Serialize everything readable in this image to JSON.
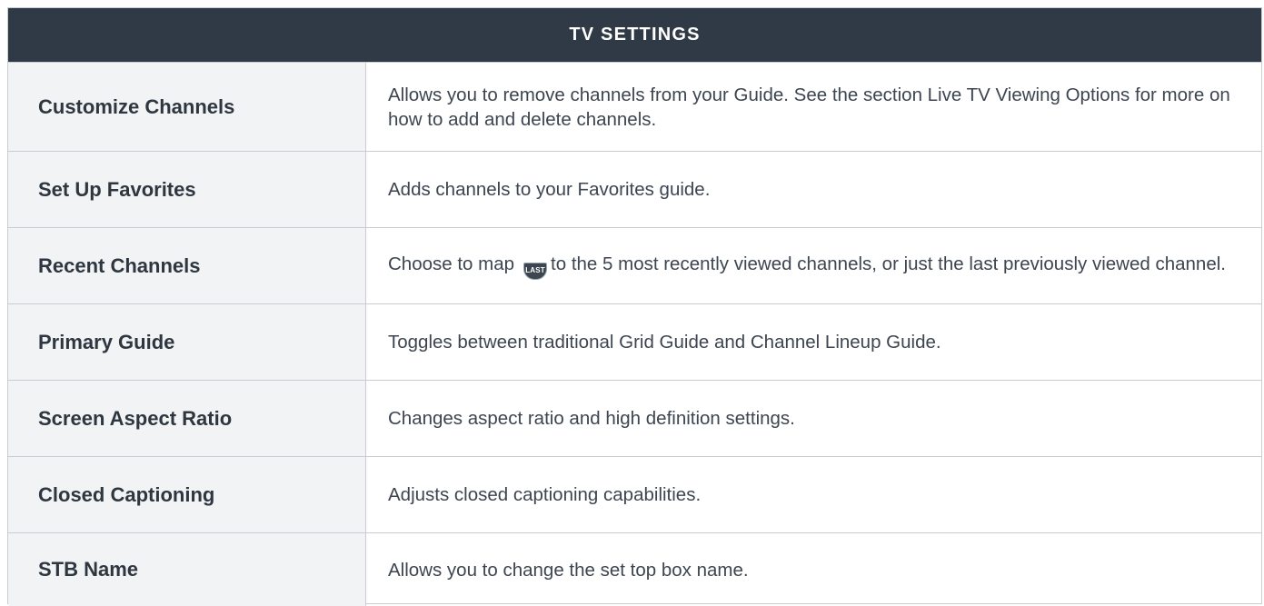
{
  "table": {
    "title": "TV SETTINGS",
    "rows": [
      {
        "label": "Customize Channels",
        "description": "Allows you to remove channels from your Guide. See the section Live TV Viewing Options for more on how to add and delete channels."
      },
      {
        "label": "Set Up Favorites",
        "description": "Adds channels to your Favorites guide."
      },
      {
        "label": "Recent Channels",
        "description_before": "Choose to map",
        "description_after": "to the 5 most recently viewed channels, or just the last previously viewed channel.",
        "key_icon": "last-button-icon",
        "key_label": "LAST"
      },
      {
        "label": "Primary Guide",
        "description": "Toggles between traditional Grid Guide and Channel Lineup Guide."
      },
      {
        "label": "Screen Aspect Ratio",
        "description": "Changes aspect ratio and high definition settings."
      },
      {
        "label": "Closed Captioning",
        "description": "Adjusts closed captioning capabilities."
      },
      {
        "label": "STB Name",
        "description": "Allows you to change the set top box name."
      }
    ]
  },
  "colors": {
    "header_bg": "#303a46",
    "label_bg": "#f2f3f4",
    "border": "#c9cdd1"
  }
}
